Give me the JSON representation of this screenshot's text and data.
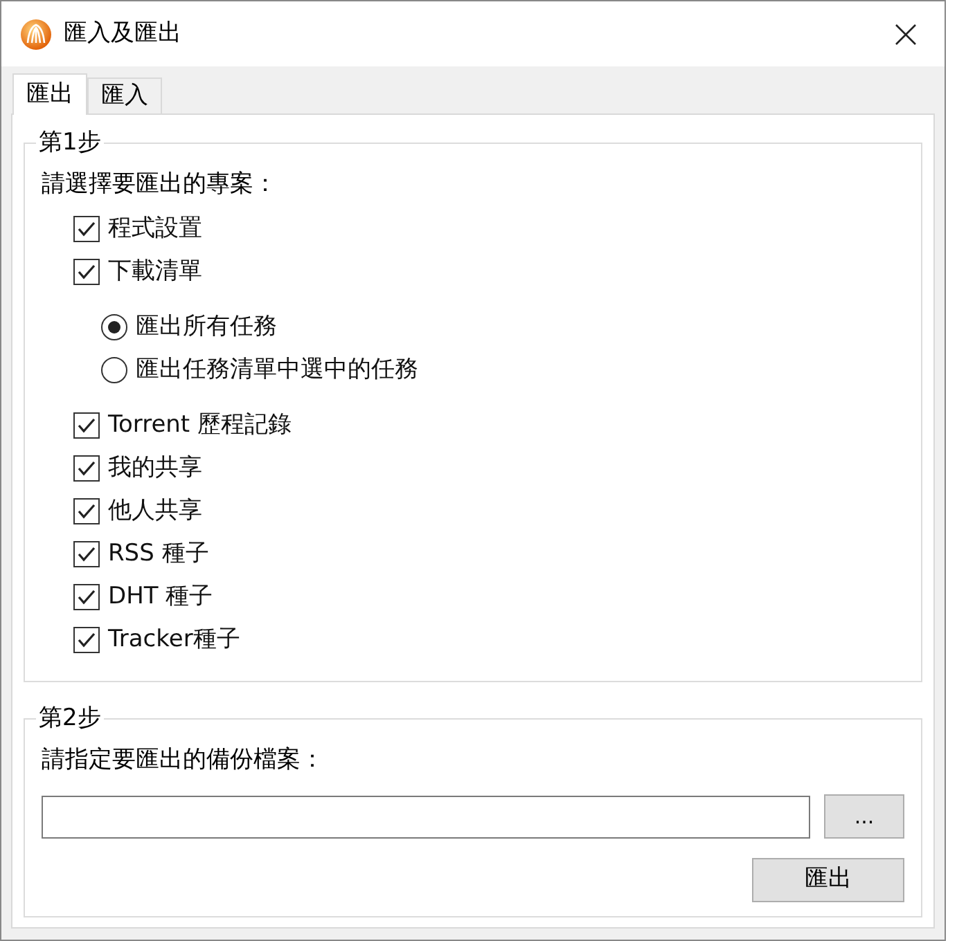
{
  "window": {
    "title": "匯入及匯出"
  },
  "tabs": [
    {
      "label": "匯出",
      "selected": true
    },
    {
      "label": "匯入",
      "selected": false
    }
  ],
  "step1": {
    "legend": "第1步",
    "prompt": "請選擇要匯出的專案：",
    "items": [
      {
        "kind": "checkbox",
        "label": "程式設置",
        "checked": true
      },
      {
        "kind": "checkbox",
        "label": "下載清單",
        "checked": true,
        "children": [
          {
            "kind": "radio",
            "label": "匯出所有任務",
            "selected": true
          },
          {
            "kind": "radio",
            "label": "匯出任務清單中選中的任務",
            "selected": false
          }
        ]
      },
      {
        "kind": "checkbox",
        "label": "Torrent 歷程記錄",
        "checked": true
      },
      {
        "kind": "checkbox",
        "label": "我的共享",
        "checked": true
      },
      {
        "kind": "checkbox",
        "label": "他人共享",
        "checked": true
      },
      {
        "kind": "checkbox",
        "label": "RSS 種子",
        "checked": true
      },
      {
        "kind": "checkbox",
        "label": "DHT 種子",
        "checked": true
      },
      {
        "kind": "checkbox",
        "label": "Tracker種子",
        "checked": true
      }
    ]
  },
  "step2": {
    "legend": "第2步",
    "prompt": "請指定要匯出的備份檔案：",
    "browse_button": "...",
    "export_button": "匯出"
  }
}
